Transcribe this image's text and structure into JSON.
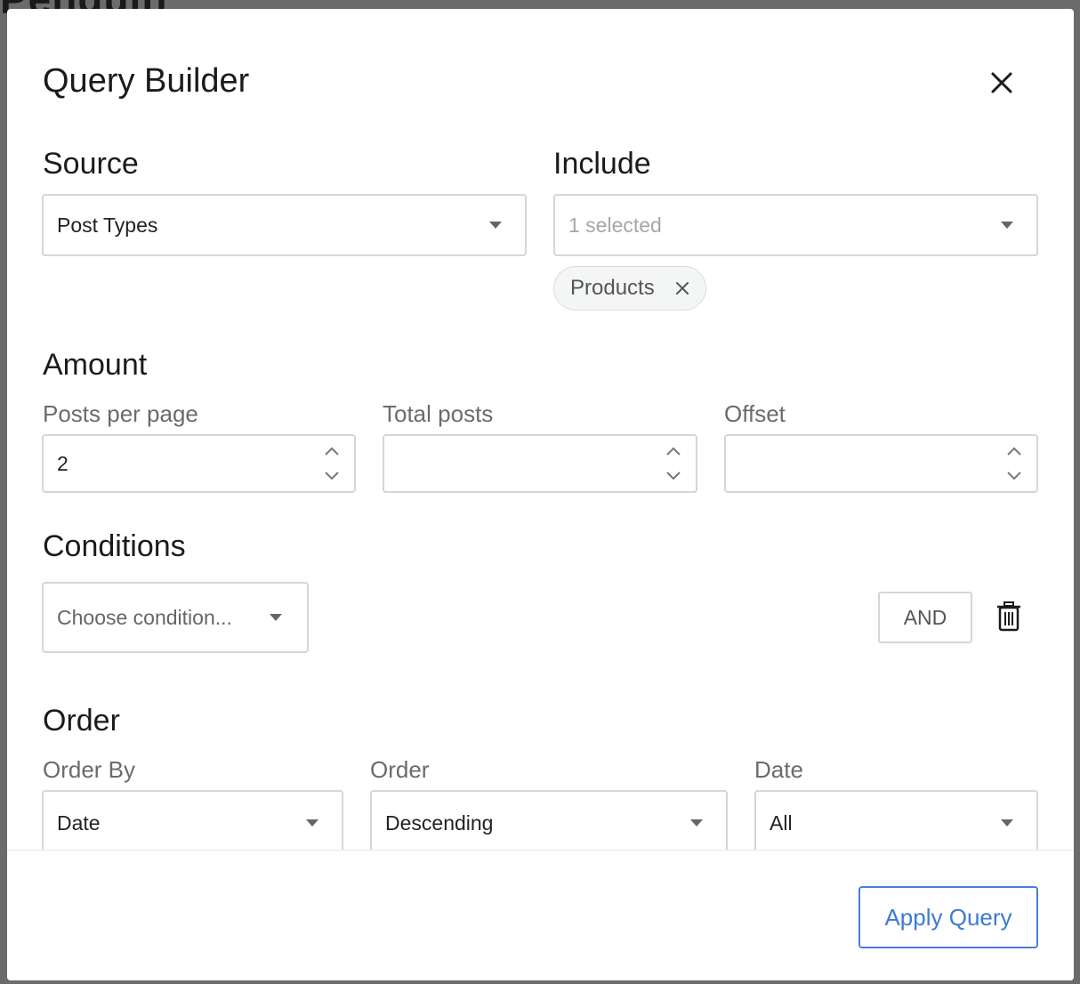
{
  "background": {
    "partial_title": "Penguin"
  },
  "modal": {
    "title": "Query Builder",
    "close_icon": "close-icon"
  },
  "source": {
    "heading": "Source",
    "value": "Post Types"
  },
  "include": {
    "heading": "Include",
    "placeholder": "1 selected",
    "chips": [
      {
        "label": "Products"
      }
    ]
  },
  "amount": {
    "heading": "Amount",
    "posts_per_page": {
      "label": "Posts per page",
      "value": "2"
    },
    "total_posts": {
      "label": "Total posts",
      "value": ""
    },
    "offset": {
      "label": "Offset",
      "value": ""
    }
  },
  "conditions": {
    "heading": "Conditions",
    "placeholder": "Choose condition...",
    "and_label": "AND",
    "delete_icon": "trash-icon"
  },
  "order": {
    "heading": "Order",
    "order_by": {
      "label": "Order By",
      "value": "Date"
    },
    "order": {
      "label": "Order",
      "value": "Descending"
    },
    "date": {
      "label": "Date",
      "value": "All"
    }
  },
  "footer": {
    "apply_label": "Apply Query"
  },
  "colors": {
    "accent": "#3e7ad3",
    "border": "#d6d6d6",
    "overlay": "#6b6b6b"
  }
}
